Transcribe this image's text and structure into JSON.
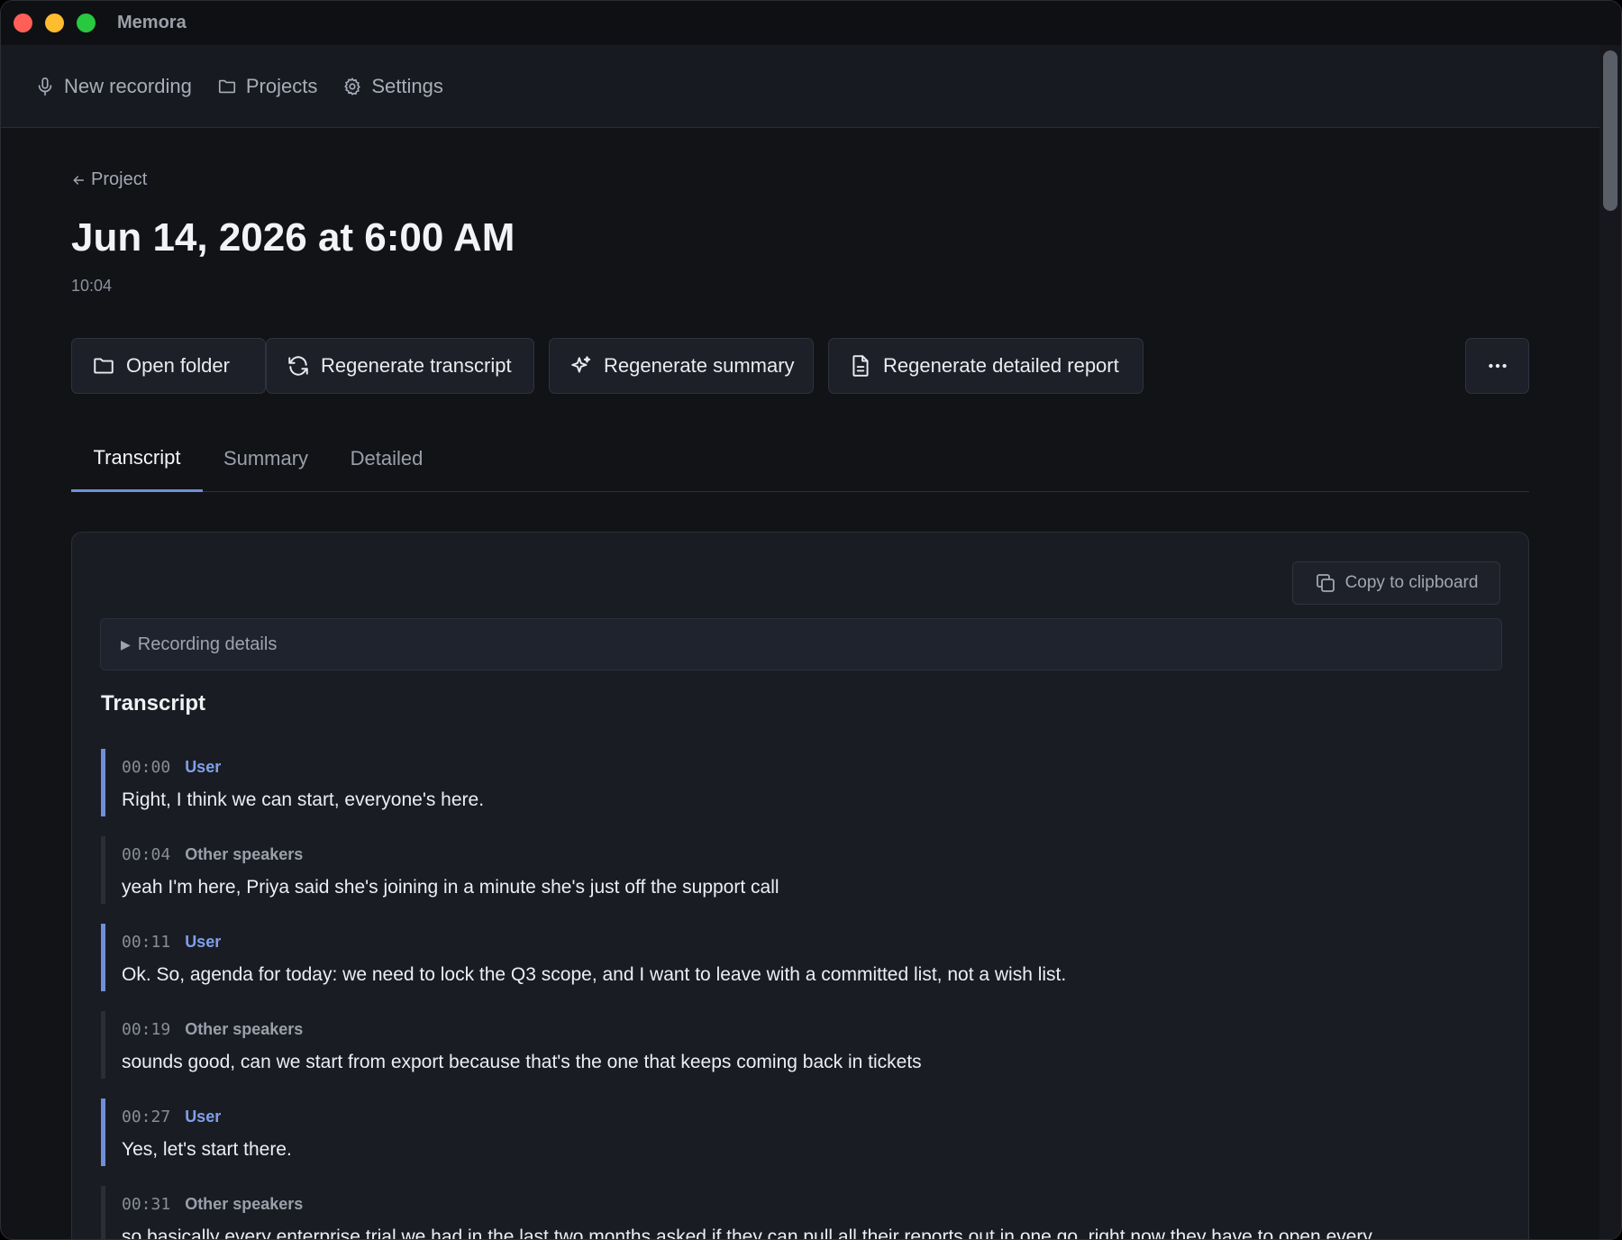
{
  "window": {
    "title": "Memora"
  },
  "nav": {
    "items": [
      {
        "label": "New recording",
        "icon": "mic-icon"
      },
      {
        "label": "Projects",
        "icon": "folder-icon"
      },
      {
        "label": "Settings",
        "icon": "gear-icon"
      }
    ]
  },
  "page": {
    "back_label": "Project",
    "title": "Jun 14, 2026 at 6:00 AM",
    "duration": "10:04"
  },
  "actions": {
    "open_folder": "Open folder",
    "regen_transcript": "Regenerate transcript",
    "regen_summary": "Regenerate summary",
    "regen_report": "Regenerate detailed report"
  },
  "tabs": [
    {
      "label": "Transcript",
      "active": true
    },
    {
      "label": "Summary",
      "active": false
    },
    {
      "label": "Detailed",
      "active": false
    }
  ],
  "panel": {
    "copy_label": "Copy to clipboard",
    "details_label": "Recording details",
    "heading": "Transcript"
  },
  "transcript": [
    {
      "time": "00:00",
      "speaker": "User",
      "text": "Right, I think we can start, everyone's here."
    },
    {
      "time": "00:04",
      "speaker": "Other speakers",
      "text": "yeah I'm here, Priya said she's joining in a minute she's just off the support call"
    },
    {
      "time": "00:11",
      "speaker": "User",
      "text": "Ok. So, agenda for today: we need to lock the Q3 scope, and I want to leave with a committed list, not a wish list."
    },
    {
      "time": "00:19",
      "speaker": "Other speakers",
      "text": "sounds good, can we start from export because that's the one that keeps coming back in tickets"
    },
    {
      "time": "00:27",
      "speaker": "User",
      "text": "Yes, let's start there."
    },
    {
      "time": "00:31",
      "speaker": "Other speakers",
      "text": "so basically every enterprise trial we had in the last two months asked if they can pull all their reports out in one go, right now they have to open every"
    }
  ],
  "colors": {
    "accent": "#6f8fd6",
    "user_speaker": "#7fa0e8",
    "background": "#111317",
    "panel": "#1a1c24"
  }
}
